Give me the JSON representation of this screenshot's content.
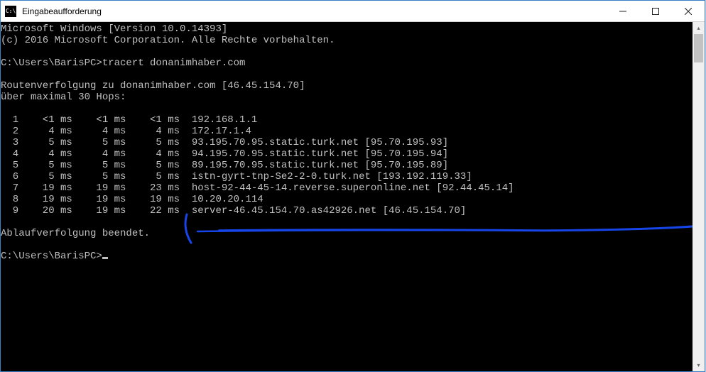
{
  "window": {
    "title": "Eingabeaufforderung",
    "icon_label": "C:\\"
  },
  "terminal": {
    "line1": "Microsoft Windows [Version 10.0.14393]",
    "line2": "(c) 2016 Microsoft Corporation. Alle Rechte vorbehalten.",
    "blank1": "",
    "prompt1": "C:\\Users\\BarisPC>tracert donanimhaber.com",
    "blank2": "",
    "trace1": "Routenverfolgung zu donanimhaber.com [46.45.154.70]",
    "trace2": "über maximal 30 Hops:",
    "blank3": "",
    "h1": "  1    <1 ms    <1 ms    <1 ms  192.168.1.1",
    "h2": "  2     4 ms     4 ms     4 ms  172.17.1.4",
    "h3": "  3     5 ms     5 ms     5 ms  93.195.70.95.static.turk.net [95.70.195.93]",
    "h4": "  4     4 ms     4 ms     4 ms  94.195.70.95.static.turk.net [95.70.195.94]",
    "h5": "  5     5 ms     5 ms     5 ms  89.195.70.95.static.turk.net [95.70.195.89]",
    "h6": "  6     5 ms     5 ms     5 ms  istn-gyrt-tnp-Se2-2-0.turk.net [193.192.119.33]",
    "h7": "  7    19 ms    19 ms    23 ms  host-92-44-45-14.reverse.superonline.net [92.44.45.14]",
    "h8": "  8    19 ms    19 ms    19 ms  10.20.20.114",
    "h9": "  9    20 ms    19 ms    22 ms  server-46.45.154.70.as42926.net [46.45.154.70]",
    "blank4": "",
    "done": "Ablaufverfolgung beendet.",
    "blank5": "",
    "prompt2": "C:\\Users\\BarisPC>"
  },
  "chart_data": {
    "type": "table",
    "title": "tracert donanimhaber.com",
    "target_ip": "46.45.154.70",
    "max_hops": 30,
    "columns": [
      "hop",
      "rtt1_ms",
      "rtt2_ms",
      "rtt3_ms",
      "host"
    ],
    "rows": [
      {
        "hop": 1,
        "rtt1_ms": 1,
        "rtt2_ms": 1,
        "rtt3_ms": 1,
        "host": "192.168.1.1"
      },
      {
        "hop": 2,
        "rtt1_ms": 4,
        "rtt2_ms": 4,
        "rtt3_ms": 4,
        "host": "172.17.1.4"
      },
      {
        "hop": 3,
        "rtt1_ms": 5,
        "rtt2_ms": 5,
        "rtt3_ms": 5,
        "host": "93.195.70.95.static.turk.net [95.70.195.93]"
      },
      {
        "hop": 4,
        "rtt1_ms": 4,
        "rtt2_ms": 4,
        "rtt3_ms": 4,
        "host": "94.195.70.95.static.turk.net [95.70.195.94]"
      },
      {
        "hop": 5,
        "rtt1_ms": 5,
        "rtt2_ms": 5,
        "rtt3_ms": 5,
        "host": "89.195.70.95.static.turk.net [95.70.195.89]"
      },
      {
        "hop": 6,
        "rtt1_ms": 5,
        "rtt2_ms": 5,
        "rtt3_ms": 5,
        "host": "istn-gyrt-tnp-Se2-2-0.turk.net [193.192.119.33]"
      },
      {
        "hop": 7,
        "rtt1_ms": 19,
        "rtt2_ms": 19,
        "rtt3_ms": 23,
        "host": "host-92-44-45-14.reverse.superonline.net [92.44.45.14]"
      },
      {
        "hop": 8,
        "rtt1_ms": 19,
        "rtt2_ms": 19,
        "rtt3_ms": 19,
        "host": "10.20.20.114"
      },
      {
        "hop": 9,
        "rtt1_ms": 20,
        "rtt2_ms": 19,
        "rtt3_ms": 22,
        "host": "server-46.45.154.70.as42926.net [46.45.154.70]"
      }
    ]
  }
}
